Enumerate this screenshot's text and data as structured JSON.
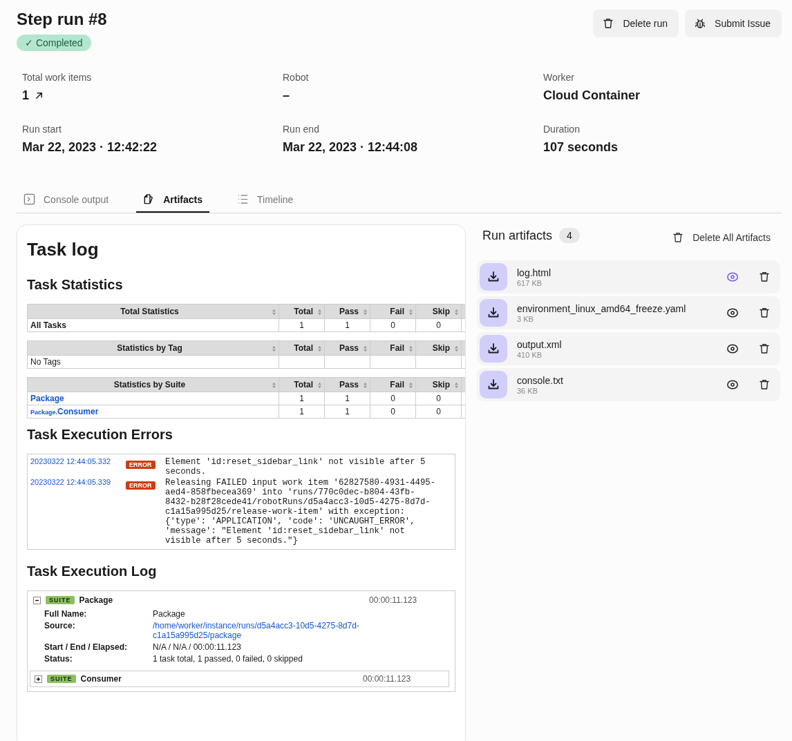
{
  "header": {
    "title": "Step run #8",
    "status": "Completed",
    "status_icon": "✓",
    "actions": [
      {
        "kind": "delete",
        "label": "Delete run"
      },
      {
        "kind": "bug",
        "label": "Submit Issue"
      }
    ]
  },
  "details": [
    {
      "label": "Total work items",
      "value": "1",
      "link": true
    },
    {
      "label": "Robot",
      "value": "–",
      "link": false
    },
    {
      "label": "Worker",
      "value": "Cloud Container",
      "link": false
    },
    {
      "label": "Run start",
      "value": "Mar 22, 2023 · 12:42:22",
      "link": false
    },
    {
      "label": "Run end",
      "value": "Mar 22, 2023 · 12:44:08",
      "link": false
    },
    {
      "label": "Duration",
      "value": "107 seconds",
      "link": false
    }
  ],
  "tabs": [
    {
      "kind": "console",
      "label": "Console output",
      "selected": false
    },
    {
      "kind": "artifacts",
      "label": "Artifacts",
      "selected": true
    },
    {
      "kind": "timeline",
      "label": "Timeline",
      "selected": false
    }
  ],
  "task_log": {
    "title": "Task log",
    "statistics_title": "Task Statistics",
    "statistics": [
      {
        "title": "Total Statistics",
        "columns": [
          "Total",
          "Pass",
          "Fail",
          "Skip"
        ],
        "rows": [
          {
            "kind": "bold",
            "name": "All Tasks",
            "values": [
              "1",
              "1",
              "0",
              "0"
            ]
          }
        ]
      },
      {
        "title": "Statistics by Tag",
        "columns": [
          "Total",
          "Pass",
          "Fail",
          "Skip"
        ],
        "rows": [
          {
            "kind": "plain",
            "name": "No Tags"
          }
        ]
      },
      {
        "title": "Statistics by Suite",
        "columns": [
          "Total",
          "Pass",
          "Fail",
          "Skip"
        ],
        "rows": [
          {
            "kind": "link",
            "name": "Package",
            "values": [
              "1",
              "1",
              "0",
              "0"
            ]
          },
          {
            "kind": "sublink",
            "parent": "Package.",
            "name": "Consumer",
            "values": [
              "1",
              "1",
              "0",
              "0"
            ]
          }
        ]
      }
    ],
    "errors_title": "Task Execution Errors",
    "errors": [
      {
        "time": "20230322 12:44:05.332",
        "level": "ERROR",
        "message": "Element 'id:reset_sidebar_link' not visible after 5 seconds."
      },
      {
        "time": "20230322 12:44:05.339",
        "level": "ERROR",
        "message": "Releasing FAILED input work item '62827580-4931-4495-aed4-858fbecea369' into 'runs/770c0dec-b804-43fb-8432-b28f28cede41/robotRuns/d5a4acc3-10d5-4275-8d7d-c1a15a995d25/release-work-item' with exception: {'type': 'APPLICATION', 'code': 'UNCAUGHT_ERROR', 'message': \"Element 'id:reset_sidebar_link' not visible after 5 seconds.\"}"
      }
    ],
    "log_title": "Task Execution Log",
    "suites": [
      {
        "type": "SUITE",
        "name": "Package",
        "elapsed": "00:00:11.123",
        "expanded": true,
        "info": [
          {
            "kind": "text",
            "label": "Full Name:",
            "value": "Package"
          },
          {
            "kind": "link",
            "label": "Source:",
            "value": "/home/worker/instance/runs/d5a4acc3-10d5-4275-8d7d-c1a15a995d25/package"
          },
          {
            "kind": "text",
            "label": "Start / End / Elapsed:",
            "value": "N/A / N/A / 00:00:11.123"
          },
          {
            "kind": "text",
            "label": "Status:",
            "value": "1 task total, 1 passed, 0 failed, 0 skipped"
          }
        ],
        "children": [
          {
            "type": "SUITE",
            "name": "Consumer",
            "elapsed": "00:00:11.123",
            "expanded": false
          }
        ]
      }
    ]
  },
  "artifacts": {
    "title": "Run artifacts",
    "count": "4",
    "delete_all": "Delete All Artifacts",
    "items": [
      {
        "name": "log.html",
        "size": "617 KB",
        "selected": true
      },
      {
        "name": "environment_linux_amd64_freeze.yaml",
        "size": "3 KB",
        "selected": false
      },
      {
        "name": "output.xml",
        "size": "410 KB",
        "selected": false
      },
      {
        "name": "console.txt",
        "size": "36 KB",
        "selected": false
      }
    ]
  }
}
